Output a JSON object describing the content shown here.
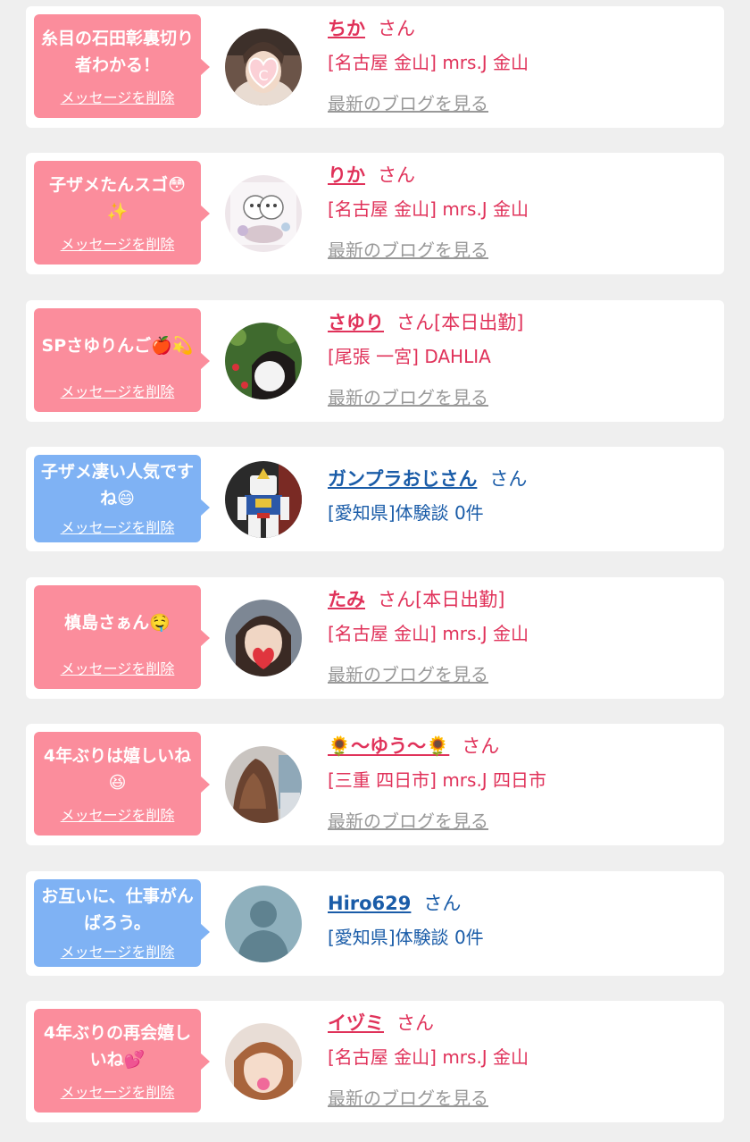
{
  "delete_label": "メッセージを削除",
  "blog_label": "最新のブログを見る",
  "honorific": "さん",
  "colors": {
    "page_bg": "#efefef",
    "card_bg": "#ffffff",
    "pink_bubble": "#fb8d9c",
    "blue_bubble": "#7fb2f4",
    "cast_text": "#e0325a",
    "member_text": "#1a5ca8",
    "blog_link": "#999999"
  },
  "messages": [
    {
      "type": "cast",
      "bubble_color": "pink",
      "message": "糸目の石田彰裏切り者わかる！",
      "name": "ちか",
      "status": "",
      "location": "[名古屋 金山] mrs.J 金山",
      "avatar_icon": "cast-photo-icon"
    },
    {
      "type": "cast",
      "bubble_color": "pink",
      "message": "子ザメたんスゴ😳✨",
      "name": "りか",
      "status": "",
      "location": "[名古屋 金山] mrs.J 金山",
      "avatar_icon": "cast-photo-icon"
    },
    {
      "type": "cast",
      "bubble_color": "pink",
      "message": "SPさゆりんご🍎💫",
      "name": "さゆり",
      "status": "[本日出勤]",
      "location": "[尾張 一宮] DAHLIA",
      "avatar_icon": "cast-photo-icon"
    },
    {
      "type": "member",
      "bubble_color": "blue",
      "message": "子ザメ凄い人気ですね😄",
      "name": "ガンプラおじさん",
      "status": "",
      "location": "[愛知県]体験談 0件",
      "avatar_icon": "robot-figure-photo-icon"
    },
    {
      "type": "cast",
      "bubble_color": "pink",
      "message": "槙島さぁん🤤",
      "name": "たみ",
      "status": "[本日出勤]",
      "location": "[名古屋 金山] mrs.J 金山",
      "avatar_icon": "cast-photo-icon"
    },
    {
      "type": "cast",
      "bubble_color": "pink",
      "message": "4年ぶりは嬉しいね😆",
      "name": "🌻～ゆう～🌻",
      "status": "",
      "location": "[三重 四日市] mrs.J 四日市",
      "avatar_icon": "cast-photo-icon"
    },
    {
      "type": "member",
      "bubble_color": "blue",
      "message": "お互いに、仕事がんばろう。",
      "name": "Hiro629",
      "status": "",
      "location": "[愛知県]体験談 0件",
      "avatar_icon": "no-photo-silhouette-icon"
    },
    {
      "type": "cast",
      "bubble_color": "pink",
      "message": "4年ぶりの再会嬉しいね💕",
      "name": "イヅミ",
      "status": "",
      "location": "[名古屋 金山] mrs.J 金山",
      "avatar_icon": "cast-photo-icon"
    }
  ]
}
